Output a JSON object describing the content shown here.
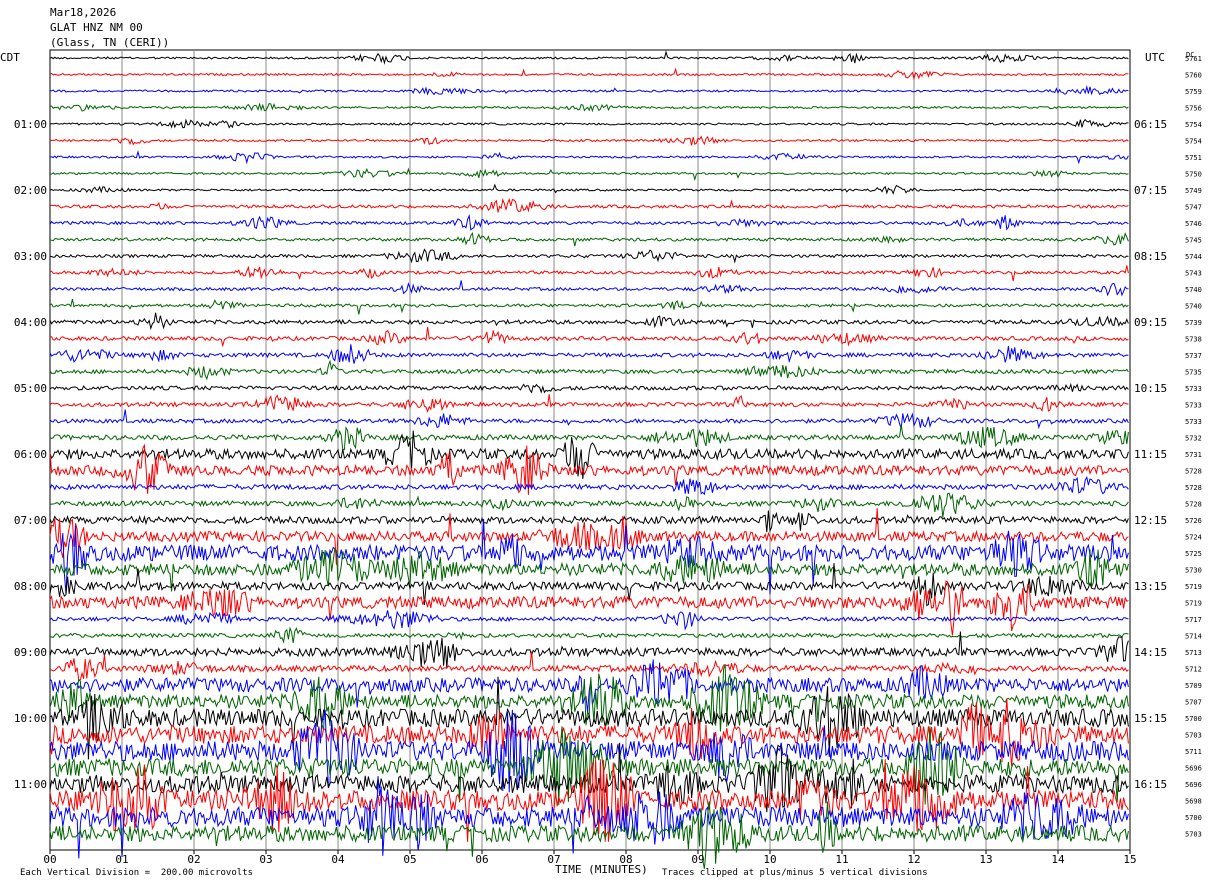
{
  "header": {
    "date": "Mar18,2026",
    "station": "GLAT HNZ NM 00",
    "location": "(Glass, TN (CERI))"
  },
  "chart_data": {
    "type": "line",
    "title": "GLAT HNZ NM 00",
    "left_axis_label": "CDT",
    "right_axis_label": "UTC",
    "dc_label": "DC",
    "xlabel": "TIME (MINUTES)",
    "xlim": [
      0,
      15
    ],
    "x_ticks": [
      "00",
      "01",
      "02",
      "03",
      "04",
      "05",
      "06",
      "07",
      "08",
      "09",
      "10",
      "11",
      "12",
      "13",
      "14",
      "15"
    ],
    "left_ticks": [
      "01:00",
      "02:00",
      "03:00",
      "04:00",
      "05:00",
      "06:00",
      "07:00",
      "08:00",
      "09:00",
      "10:00",
      "11:00"
    ],
    "right_ticks": [
      "06:15",
      "07:15",
      "08:15",
      "09:15",
      "10:15",
      "11:15",
      "12:15",
      "13:15",
      "14:15",
      "15:15",
      "16:15"
    ],
    "trace_colors": [
      "#000000",
      "#ff0000",
      "#0000ff",
      "#006400"
    ],
    "trace_amplitudes": [
      1,
      1,
      1,
      1,
      1,
      1,
      1,
      1,
      1,
      1.5,
      1.5,
      1.5,
      1.5,
      1.5,
      1.5,
      1.5,
      2,
      2,
      2,
      2,
      2,
      2,
      2,
      2.5,
      5,
      5,
      2.5,
      2.5,
      3.5,
      5,
      8,
      6,
      4,
      6,
      2,
      2,
      4,
      3,
      7,
      7,
      9,
      9,
      10,
      9,
      9,
      10,
      10,
      8
    ],
    "dc_offsets": [
      "5761",
      "5760",
      "5759",
      "5756",
      "5754",
      "5754",
      "5751",
      "5750",
      "5749",
      "5747",
      "5746",
      "5745",
      "5744",
      "5743",
      "5740",
      "5740",
      "5739",
      "5738",
      "5737",
      "5735",
      "5733",
      "5733",
      "5733",
      "5732",
      "5731",
      "5728",
      "5728",
      "5728",
      "5726",
      "5724",
      "5725",
      "5730",
      "5719",
      "5719",
      "5717",
      "5714",
      "5713",
      "5712",
      "5709",
      "5707",
      "5700",
      "5703",
      "5711",
      "5696",
      "5696",
      "5698",
      "5700",
      "5703"
    ],
    "footnote_left": "Each Vertical Division =  200.00 microvolts",
    "footnote_right": "Traces clipped at plus/minus 5 vertical divisions"
  }
}
